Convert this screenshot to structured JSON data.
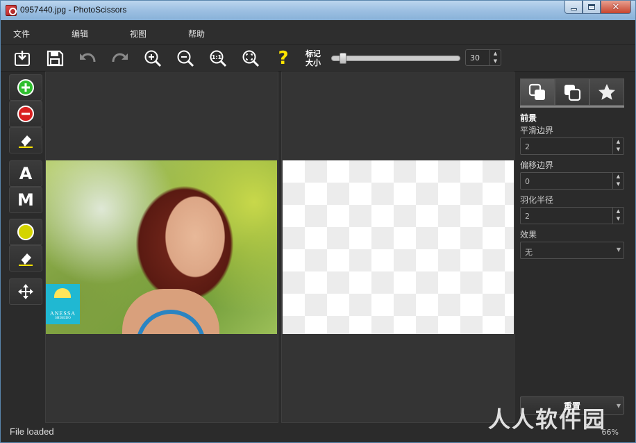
{
  "window": {
    "title": "0957440.jpg - PhotoScissors"
  },
  "menu": [
    {
      "label": "文件"
    },
    {
      "label": "编辑"
    },
    {
      "label": "视图"
    },
    {
      "label": "帮助"
    }
  ],
  "toolbar": {
    "brush_label_line1": "标记",
    "brush_label_line2": "大小",
    "brush_size": "30",
    "brush_size_fraction": 0.07,
    "help_symbol": "?"
  },
  "left_tools": {
    "auto_letter": "A",
    "manual_letter": "M",
    "colors": {
      "add": "#2fbf2f",
      "remove": "#d92020",
      "mark": "#d4d400"
    }
  },
  "photo": {
    "logo_text": "ANESSA",
    "logo_sub": "SHISEIDO"
  },
  "right_panel": {
    "section_title": "前景",
    "smooth_label": "平滑边界",
    "smooth_value": "2",
    "offset_label": "偏移边界",
    "offset_value": "0",
    "feather_label": "羽化半径",
    "feather_value": "2",
    "effect_label": "效果",
    "effect_value": "无",
    "reset_label": "重置"
  },
  "status": {
    "text": "File loaded",
    "zoom": "66%"
  },
  "watermark": "人人软件园"
}
